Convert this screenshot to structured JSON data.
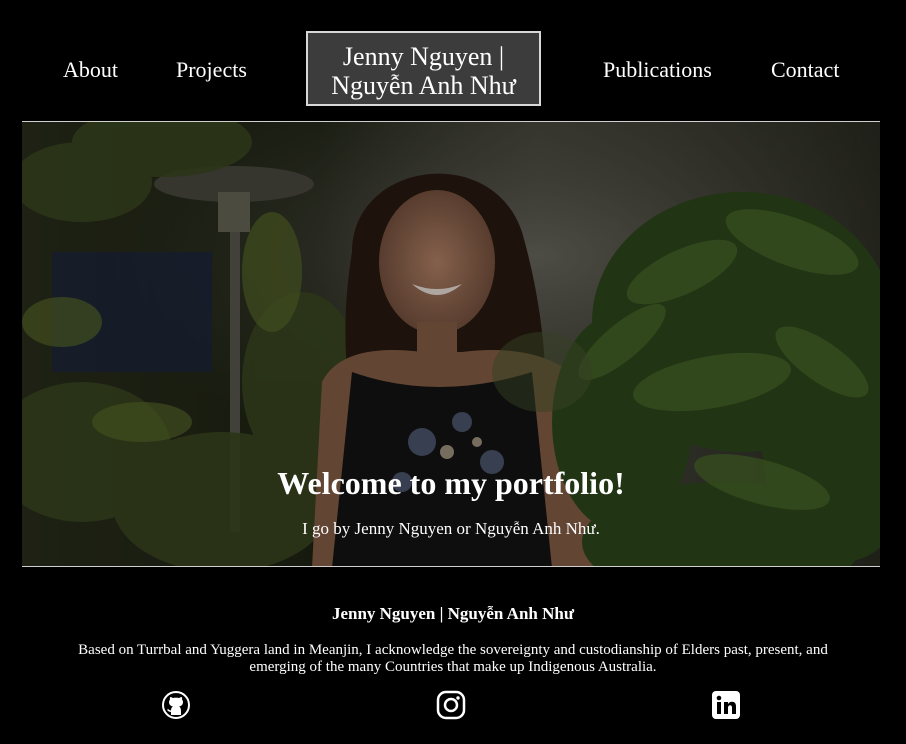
{
  "nav": {
    "about": "About",
    "projects": "Projects",
    "publications": "Publications",
    "contact": "Contact",
    "brand_line1": "Jenny Nguyen |",
    "brand_line2": "Nguyễn Anh Như"
  },
  "hero": {
    "title": "Welcome to my portfolio!",
    "subtitle": "I go by Jenny Nguyen or Nguyễn Anh Như."
  },
  "footer": {
    "name": "Jenny Nguyen | Nguyễn Anh Như",
    "acknowledgement": "Based on Turrbal and Yuggera land in Meanjin, I acknowledge the sovereignty and custodianship of Elders past, present, and emerging of the many Countries that make up Indigenous Australia.",
    "social_icons": [
      "github-icon",
      "instagram-icon",
      "linkedin-icon"
    ]
  },
  "colors": {
    "background": "#000000",
    "text": "#ffffff",
    "brand_box": "#3c3c3c",
    "border": "#d8d8d8"
  }
}
